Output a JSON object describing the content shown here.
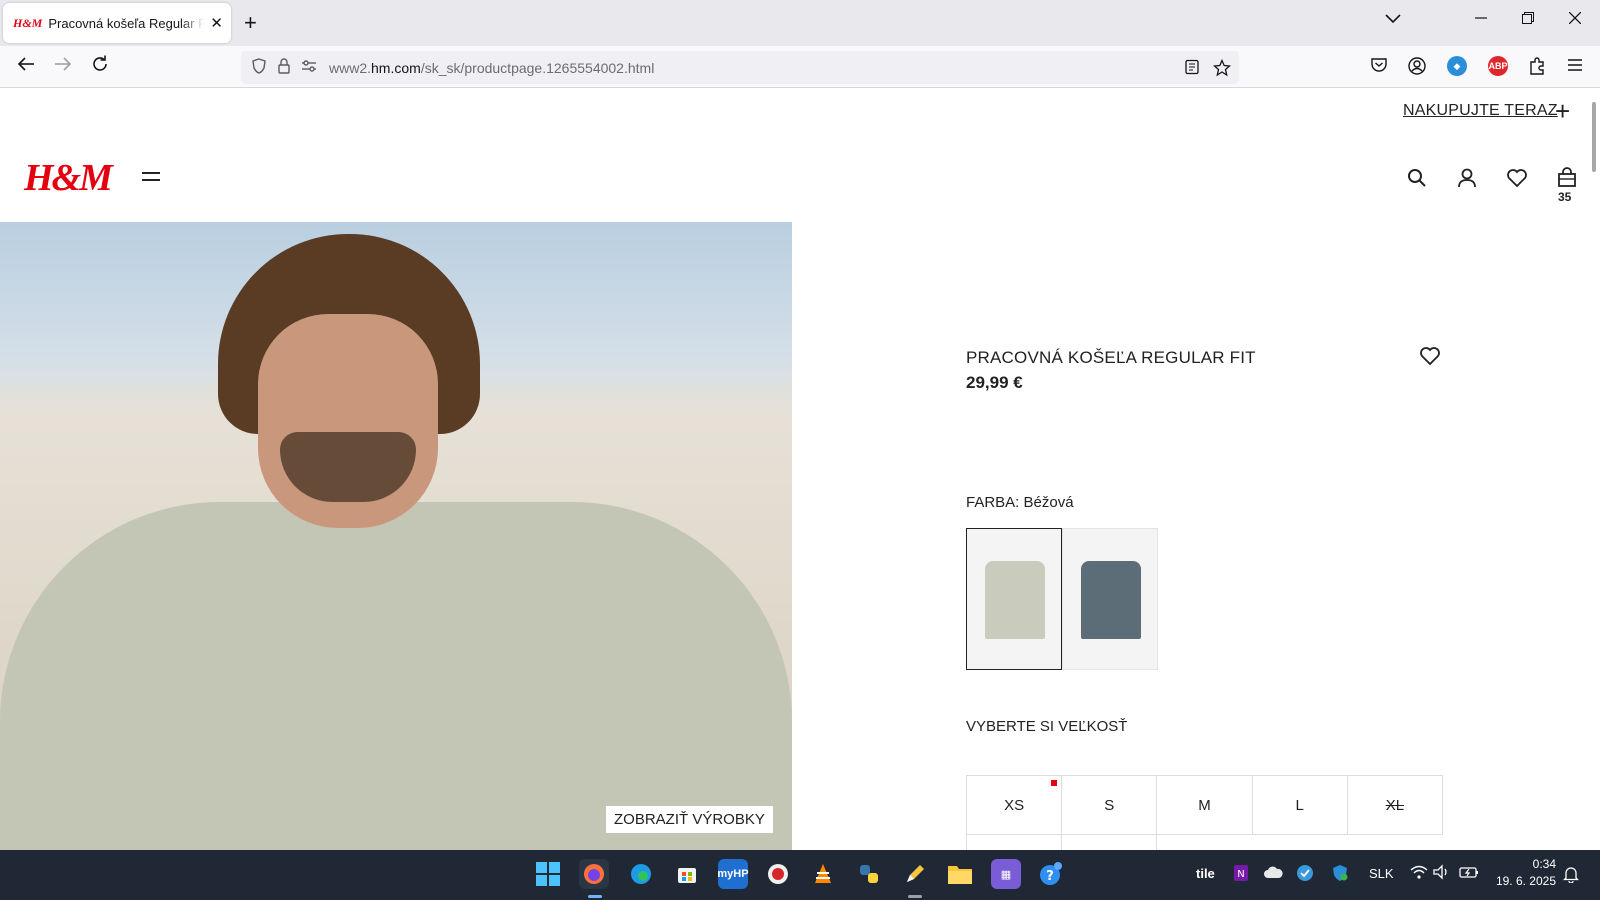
{
  "browser": {
    "tab_title": "Pracovná košeľa Regular Fit - Béžová - MEN | H&M SK",
    "tab_favicon": "H&M",
    "url_prefix": "www2.",
    "url_domain": "hm.com",
    "url_path": "/sk_sk/productpage.1265554002.html",
    "icons": [
      "back-icon",
      "forward-icon",
      "reload-icon",
      "shield-icon",
      "lock-icon",
      "permissions-icon",
      "reader-icon",
      "star-icon",
      "pocket-icon",
      "account-icon",
      "extensions-icon",
      "menu-icon"
    ],
    "ext_abp": "ABP"
  },
  "page": {
    "shop_now": "NAKUPUJTE TERAZ",
    "logo": "H&M",
    "cart_count": "35",
    "show_products": "ZOBRAZIŤ VÝROBKY",
    "product": {
      "title": "PRACOVNÁ KOŠEĽA REGULAR FIT",
      "price": "29,99 €",
      "color_label": "FARBA: Béžová",
      "swatches": [
        {
          "color": "#c9ccbd",
          "selected": true
        },
        {
          "color": "#5d6d78",
          "selected": false
        }
      ],
      "size_label": "VYBERTE SI VEĽKOSŤ",
      "sizes": [
        {
          "label": "XS",
          "low_stock": true,
          "sold_out": false
        },
        {
          "label": "S",
          "low_stock": false,
          "sold_out": false
        },
        {
          "label": "M",
          "low_stock": false,
          "sold_out": false
        },
        {
          "label": "L",
          "low_stock": false,
          "sold_out": false
        },
        {
          "label": "XL",
          "low_stock": false,
          "sold_out": true
        }
      ]
    },
    "accent": "#e50010"
  },
  "taskbar": {
    "hp_label": "myHP",
    "tray_tile": "tile",
    "language": "SLK",
    "time": "0:34",
    "date": "19. 6. 2025"
  }
}
